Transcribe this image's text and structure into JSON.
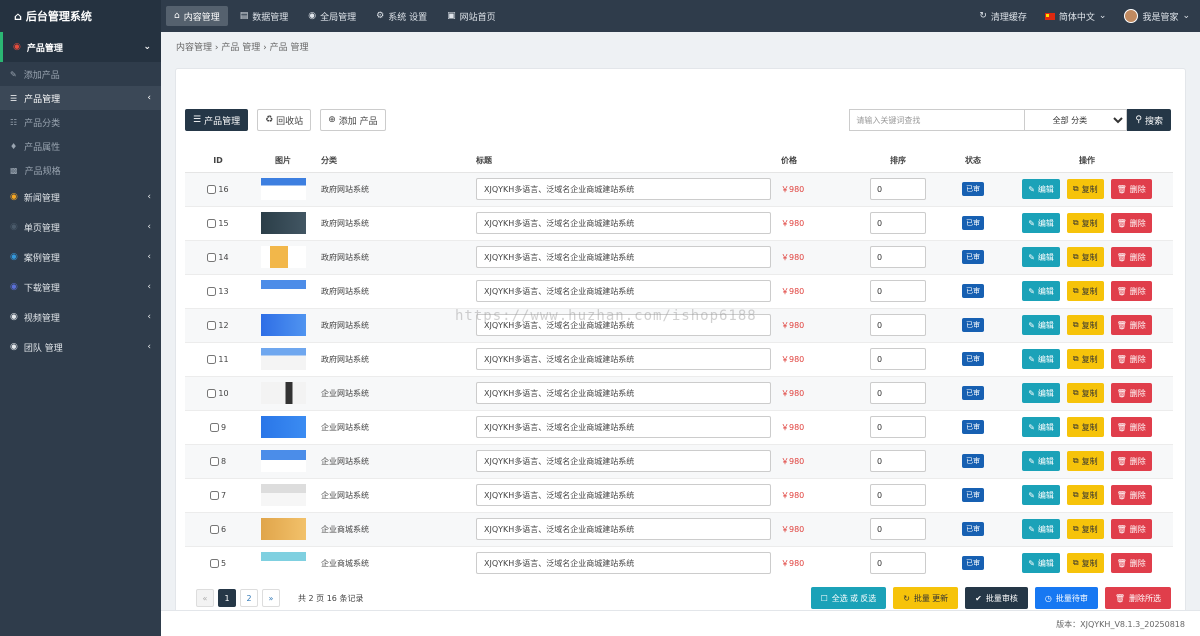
{
  "header": {
    "brand": "后台管理系统",
    "nav": [
      {
        "label": "内容管理",
        "icon": "home-icon",
        "active": true
      },
      {
        "label": "数据管理",
        "icon": "chart-icon",
        "active": false
      },
      {
        "label": "全局管理",
        "icon": "globe-icon",
        "active": false
      },
      {
        "label": "系统 设置",
        "icon": "gear-icon",
        "active": false
      },
      {
        "label": "网站首页",
        "icon": "monitor-icon",
        "active": false
      }
    ],
    "clear_cache": "清理缓存",
    "language": "简体中文",
    "user": "我是管家"
  },
  "sidebar": {
    "groups": [
      {
        "label": "产品管理",
        "open": true,
        "color": "#e74c3c",
        "items": [
          {
            "label": "添加产品",
            "icon": "edit-icon"
          },
          {
            "label": "产品管理",
            "icon": "list-icon",
            "active": true
          },
          {
            "label": "产品分类",
            "icon": "sitemap-icon"
          },
          {
            "label": "产品属性",
            "icon": "tag-icon"
          },
          {
            "label": "产品规格",
            "icon": "cubes-icon"
          }
        ]
      },
      {
        "label": "新闻管理",
        "color": "#f5a623"
      },
      {
        "label": "单页管理",
        "color": "#2c3e50"
      },
      {
        "label": "案例管理",
        "color": "#3498db"
      },
      {
        "label": "下载管理",
        "color": "#5b6fd6"
      },
      {
        "label": "视频管理",
        "color": "#ffffff"
      },
      {
        "label": "团队 管理",
        "color": "#ffffff"
      }
    ]
  },
  "breadcrumb": [
    "内容管理",
    "产品 管理",
    "产品 管理"
  ],
  "toolbar": {
    "manage": "产品管理",
    "recycle": "回收站",
    "add": "添加 产品",
    "search_placeholder": "请输入关键词查找",
    "category_select": "全部 分类",
    "search_button": "搜索"
  },
  "table": {
    "headers": [
      "ID",
      "图片",
      "分类",
      "标题",
      "价格",
      "排序",
      "状态",
      "操作"
    ],
    "op_labels": {
      "edit": "编辑",
      "copy": "复制",
      "delete": "删除"
    },
    "rows": [
      {
        "id": "16",
        "category": "政府网站系统",
        "title": "XJQYKH多语言、泛域名企业商城建站系统",
        "price": "￥980",
        "sort": "0",
        "status": "已审"
      },
      {
        "id": "15",
        "category": "政府网站系统",
        "title": "XJQYKH多语言、泛域名企业商城建站系统",
        "price": "￥980",
        "sort": "0",
        "status": "已审"
      },
      {
        "id": "14",
        "category": "政府网站系统",
        "title": "XJQYKH多语言、泛域名企业商城建站系统",
        "price": "￥980",
        "sort": "0",
        "status": "已审"
      },
      {
        "id": "13",
        "category": "政府网站系统",
        "title": "XJQYKH多语言、泛域名企业商城建站系统",
        "price": "￥980",
        "sort": "0",
        "status": "已审"
      },
      {
        "id": "12",
        "category": "政府网站系统",
        "title": "XJQYKH多语言、泛域名企业商城建站系统",
        "price": "￥980",
        "sort": "0",
        "status": "已审"
      },
      {
        "id": "11",
        "category": "政府网站系统",
        "title": "XJQYKH多语言、泛域名企业商城建站系统",
        "price": "￥980",
        "sort": "0",
        "status": "已审"
      },
      {
        "id": "10",
        "category": "企业网站系统",
        "title": "XJQYKH多语言、泛域名企业商城建站系统",
        "price": "￥980",
        "sort": "0",
        "status": "已审"
      },
      {
        "id": "9",
        "category": "企业网站系统",
        "title": "XJQYKH多语言、泛域名企业商城建站系统",
        "price": "￥980",
        "sort": "0",
        "status": "已审"
      },
      {
        "id": "8",
        "category": "企业网站系统",
        "title": "XJQYKH多语言、泛域名企业商城建站系统",
        "price": "￥980",
        "sort": "0",
        "status": "已审"
      },
      {
        "id": "7",
        "category": "企业网站系统",
        "title": "XJQYKH多语言、泛域名企业商城建站系统",
        "price": "￥980",
        "sort": "0",
        "status": "已审"
      },
      {
        "id": "6",
        "category": "企业商城系统",
        "title": "XJQYKH多语言、泛域名企业商城建站系统",
        "price": "￥980",
        "sort": "0",
        "status": "已审"
      },
      {
        "id": "5",
        "category": "企业商城系统",
        "title": "XJQYKH多语言、泛域名企业商城建站系统",
        "price": "￥980",
        "sort": "0",
        "status": "已审"
      }
    ]
  },
  "pagination": {
    "prev": "«",
    "pages": [
      "1",
      "2"
    ],
    "current": "1",
    "next": "»",
    "info": "共 2 页 16 条记录"
  },
  "bulk": {
    "select_all": "全选 或 反选",
    "batch_update": "批量 更新",
    "batch_review": "批量审核",
    "batch_pending": "批量待审",
    "delete_selected": "删除所选"
  },
  "footer": {
    "version": "版本：XJQYKH_V8.1.3_20250818"
  },
  "watermark": "https://www.huzhan.com/ishop6188"
}
